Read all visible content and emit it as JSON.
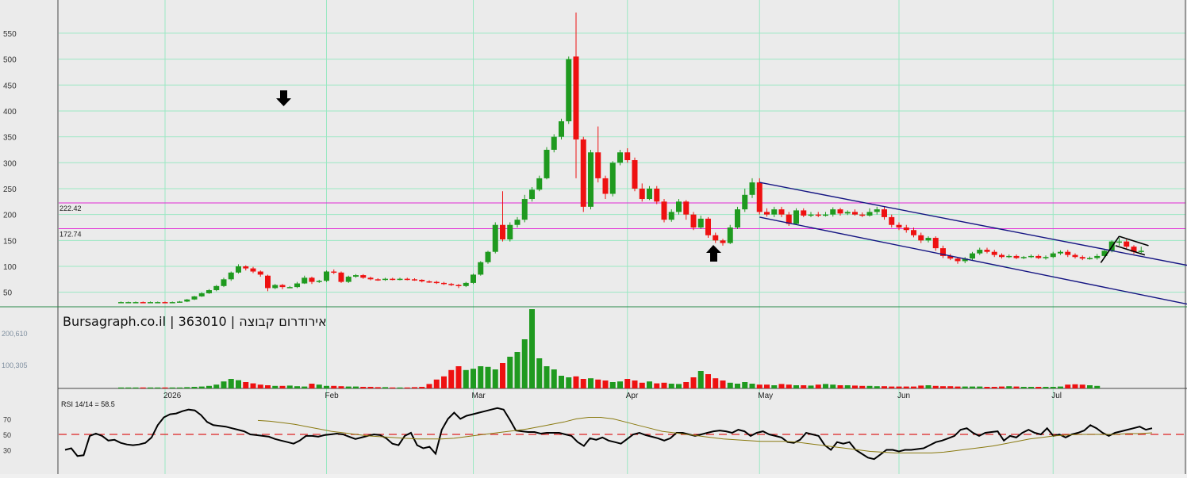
{
  "chart_data": {
    "type": "candlestick",
    "title": "Bursagraph.co.il | 363010 | אירודרום קבוצה",
    "colors": {
      "up": "#1f9a1f",
      "down": "#ee1111",
      "grid": "#9be8c3",
      "hline": "#e22ad6",
      "channel": "#141482",
      "rsi": "#000000",
      "rsi_ma": "#8a7a10",
      "rsi_level": "#dd2222",
      "background": "#ebebeb"
    },
    "price_axis": {
      "ticks": [
        50,
        100,
        150,
        200,
        250,
        300,
        350,
        400,
        450,
        500,
        550
      ],
      "ylim": [
        25,
        600
      ]
    },
    "horizontal_levels": [
      {
        "label": "222.42",
        "value": 222.42
      },
      {
        "label": "172.74",
        "value": 172.74
      }
    ],
    "month_labels": [
      {
        "label": "2026",
        "day": 0
      },
      {
        "label": "Feb",
        "day": 22
      },
      {
        "label": "Mar",
        "day": 42
      },
      {
        "label": "Apr",
        "day": 63
      },
      {
        "label": "May",
        "day": 81
      },
      {
        "label": "Jun",
        "day": 100
      },
      {
        "label": "Jul",
        "day": 121
      }
    ],
    "grid_days": [
      -15,
      0,
      22,
      42,
      63,
      81,
      100,
      121,
      140
    ],
    "candles": [
      [
        -6,
        30,
        31,
        32,
        29
      ],
      [
        -5,
        30,
        31,
        32,
        29
      ],
      [
        -4,
        30,
        31,
        32,
        29
      ],
      [
        -3,
        31,
        30,
        32,
        29
      ],
      [
        -2,
        30,
        31,
        32,
        29
      ],
      [
        -1,
        31,
        31,
        32,
        29
      ],
      [
        0,
        31,
        30,
        32,
        29
      ],
      [
        1,
        30,
        31,
        32,
        29
      ],
      [
        2,
        31,
        32,
        33,
        30
      ],
      [
        3,
        32,
        36,
        37,
        31
      ],
      [
        4,
        36,
        42,
        43,
        35
      ],
      [
        5,
        42,
        48,
        50,
        41
      ],
      [
        6,
        48,
        54,
        56,
        47
      ],
      [
        7,
        54,
        62,
        64,
        52
      ],
      [
        8,
        62,
        75,
        78,
        60
      ],
      [
        9,
        75,
        88,
        90,
        72
      ],
      [
        10,
        88,
        100,
        104,
        86
      ],
      [
        11,
        100,
        96,
        102,
        92
      ],
      [
        12,
        96,
        90,
        99,
        87
      ],
      [
        13,
        90,
        84,
        92,
        80
      ],
      [
        14,
        82,
        58,
        84,
        52
      ],
      [
        15,
        58,
        64,
        66,
        56
      ],
      [
        16,
        64,
        60,
        66,
        56
      ],
      [
        17,
        60,
        60,
        62,
        58
      ],
      [
        18,
        60,
        67,
        70,
        58
      ],
      [
        19,
        67,
        78,
        82,
        66
      ],
      [
        20,
        78,
        70,
        80,
        66
      ],
      [
        21,
        70,
        72,
        74,
        68
      ],
      [
        22,
        72,
        90,
        92,
        70
      ],
      [
        23,
        90,
        88,
        94,
        85
      ],
      [
        24,
        88,
        70,
        90,
        68
      ],
      [
        25,
        70,
        80,
        82,
        68
      ],
      [
        26,
        80,
        83,
        85,
        78
      ],
      [
        27,
        83,
        78,
        85,
        76
      ],
      [
        28,
        78,
        75,
        80,
        73
      ],
      [
        29,
        75,
        74,
        77,
        72
      ],
      [
        30,
        74,
        76,
        78,
        72
      ],
      [
        31,
        76,
        75,
        78,
        73
      ],
      [
        32,
        75,
        76,
        78,
        73
      ],
      [
        33,
        76,
        75,
        78,
        73
      ],
      [
        34,
        75,
        74,
        77,
        72
      ],
      [
        35,
        74,
        71,
        75,
        69
      ],
      [
        36,
        71,
        70,
        73,
        68
      ],
      [
        37,
        70,
        68,
        72,
        66
      ],
      [
        38,
        68,
        66,
        70,
        64
      ],
      [
        39,
        66,
        64,
        68,
        62
      ],
      [
        40,
        64,
        62,
        66,
        58
      ],
      [
        41,
        62,
        68,
        70,
        60
      ],
      [
        42,
        68,
        84,
        86,
        66
      ],
      [
        43,
        84,
        108,
        110,
        82
      ],
      [
        44,
        108,
        128,
        130,
        105
      ],
      [
        45,
        128,
        180,
        185,
        125
      ],
      [
        46,
        180,
        152,
        245,
        148
      ],
      [
        47,
        152,
        180,
        185,
        148
      ],
      [
        48,
        180,
        190,
        195,
        175
      ],
      [
        49,
        190,
        230,
        238,
        185
      ],
      [
        50,
        230,
        248,
        253,
        225
      ],
      [
        51,
        248,
        270,
        275,
        245
      ],
      [
        52,
        270,
        325,
        330,
        268
      ],
      [
        53,
        325,
        350,
        355,
        320
      ],
      [
        54,
        350,
        380,
        385,
        345
      ],
      [
        55,
        380,
        500,
        505,
        375
      ],
      [
        56,
        505,
        345,
        590,
        270
      ],
      [
        57,
        345,
        215,
        350,
        205
      ],
      [
        58,
        215,
        320,
        325,
        210
      ],
      [
        59,
        320,
        270,
        370,
        262
      ],
      [
        60,
        270,
        240,
        275,
        230
      ],
      [
        61,
        240,
        300,
        303,
        235
      ],
      [
        62,
        300,
        320,
        325,
        295
      ],
      [
        63,
        320,
        305,
        328,
        300
      ],
      [
        64,
        305,
        250,
        310,
        245
      ],
      [
        65,
        250,
        230,
        260,
        225
      ],
      [
        66,
        230,
        250,
        255,
        228
      ],
      [
        67,
        250,
        225,
        255,
        220
      ],
      [
        68,
        225,
        190,
        230,
        185
      ],
      [
        69,
        190,
        205,
        210,
        186
      ],
      [
        70,
        205,
        225,
        230,
        200
      ],
      [
        71,
        225,
        200,
        228,
        190
      ],
      [
        72,
        200,
        175,
        205,
        170
      ],
      [
        73,
        175,
        192,
        198,
        172
      ],
      [
        74,
        192,
        160,
        195,
        155
      ],
      [
        75,
        160,
        150,
        165,
        145
      ],
      [
        76,
        150,
        145,
        153,
        140
      ],
      [
        77,
        145,
        175,
        180,
        143
      ],
      [
        78,
        175,
        210,
        215,
        172
      ],
      [
        79,
        210,
        238,
        250,
        205
      ],
      [
        80,
        238,
        262,
        270,
        232
      ],
      [
        81,
        262,
        205,
        270,
        200
      ],
      [
        82,
        205,
        200,
        212,
        196
      ],
      [
        83,
        200,
        210,
        215,
        195
      ],
      [
        84,
        210,
        200,
        215,
        195
      ],
      [
        85,
        200,
        182,
        205,
        178
      ],
      [
        86,
        182,
        208,
        212,
        180
      ],
      [
        87,
        208,
        198,
        212,
        195
      ],
      [
        88,
        198,
        200,
        205,
        195
      ],
      [
        89,
        200,
        198,
        205,
        195
      ],
      [
        90,
        198,
        200,
        205,
        196
      ],
      [
        91,
        200,
        210,
        214,
        196
      ],
      [
        92,
        210,
        202,
        213,
        198
      ],
      [
        93,
        202,
        205,
        208,
        199
      ],
      [
        94,
        205,
        200,
        210,
        198
      ],
      [
        95,
        200,
        198,
        204,
        195
      ],
      [
        96,
        198,
        205,
        212,
        196
      ],
      [
        97,
        205,
        210,
        215,
        200
      ],
      [
        98,
        210,
        195,
        215,
        190
      ],
      [
        99,
        195,
        180,
        200,
        175
      ],
      [
        100,
        180,
        175,
        185,
        170
      ],
      [
        101,
        175,
        170,
        180,
        165
      ],
      [
        102,
        170,
        160,
        175,
        156
      ],
      [
        103,
        160,
        150,
        165,
        145
      ],
      [
        104,
        150,
        155,
        158,
        146
      ],
      [
        105,
        155,
        135,
        158,
        130
      ],
      [
        106,
        135,
        120,
        140,
        116
      ],
      [
        107,
        120,
        115,
        124,
        112
      ],
      [
        108,
        115,
        110,
        118,
        105
      ],
      [
        109,
        110,
        115,
        118,
        106
      ],
      [
        110,
        115,
        125,
        128,
        112
      ],
      [
        111,
        125,
        132,
        136,
        122
      ],
      [
        112,
        132,
        128,
        136,
        125
      ],
      [
        113,
        128,
        122,
        132,
        118
      ],
      [
        114,
        122,
        118,
        125,
        115
      ],
      [
        115,
        118,
        120,
        123,
        116
      ],
      [
        116,
        120,
        116,
        123,
        114
      ],
      [
        117,
        116,
        118,
        120,
        114
      ],
      [
        118,
        118,
        120,
        123,
        116
      ],
      [
        119,
        120,
        116,
        123,
        114
      ],
      [
        120,
        116,
        118,
        121,
        113
      ],
      [
        121,
        118,
        125,
        128,
        116
      ],
      [
        122,
        125,
        128,
        131,
        122
      ],
      [
        123,
        128,
        122,
        132,
        118
      ],
      [
        124,
        122,
        118,
        125,
        115
      ],
      [
        125,
        118,
        115,
        121,
        112
      ],
      [
        126,
        115,
        116,
        119,
        113
      ],
      [
        127,
        116,
        120,
        124,
        113
      ],
      [
        128,
        120,
        130,
        133,
        117
      ],
      [
        129,
        130,
        148,
        150,
        127
      ],
      [
        130,
        148,
        148,
        155,
        140
      ],
      [
        131,
        148,
        138,
        152,
        134
      ],
      [
        132,
        138,
        128,
        141,
        124
      ],
      [
        133,
        128,
        130,
        138,
        126
      ]
    ],
    "volume": {
      "ticks": [
        {
          "label": "100,305",
          "value": 100305
        },
        {
          "label": "200,610",
          "value": 200610
        }
      ],
      "ymax": 250000,
      "values": [
        3000,
        3000,
        3000,
        3000,
        3000,
        3000,
        3000,
        3000,
        3000,
        4000,
        5000,
        6000,
        8000,
        12000,
        22000,
        30000,
        26000,
        20000,
        16000,
        12000,
        10000,
        8000,
        8000,
        9000,
        7000,
        6000,
        15000,
        12000,
        8000,
        8000,
        7000,
        6000,
        6000,
        5000,
        5000,
        4000,
        4000,
        3000,
        3000,
        3000,
        4000,
        5000,
        14000,
        28000,
        38000,
        58000,
        70000,
        58000,
        62000,
        70000,
        68000,
        60000,
        80000,
        100000,
        115000,
        155000,
        250000,
        95000,
        70000,
        60000,
        40000,
        35000,
        38000,
        30000,
        32000,
        28000,
        25000,
        20000,
        22000,
        30000,
        25000,
        18000,
        22000,
        16000,
        18000,
        15000,
        14000,
        20000,
        35000,
        55000,
        45000,
        32000,
        25000,
        18000,
        15000,
        20000,
        15000,
        12000,
        12000,
        10000,
        14000,
        12000,
        10000,
        10000,
        9000,
        12000,
        14000,
        12000,
        10000,
        10000,
        9000,
        8000,
        8000,
        7000,
        7000,
        6000,
        6000,
        6000,
        6000,
        9000,
        10000,
        8000,
        7000,
        7000,
        6000,
        6000,
        6000,
        6000,
        5000,
        5000,
        6000,
        7000,
        6000,
        5000,
        5000,
        5000,
        5000,
        5000,
        6000,
        12000,
        13000,
        12000,
        10000,
        8000
      ]
    },
    "rsi": {
      "label": "RSI 14/14 = 58.5",
      "ticks": [
        30,
        50,
        70
      ],
      "level": 50,
      "values": [
        30,
        32,
        22,
        23,
        48,
        51,
        48,
        42,
        43,
        39,
        37,
        36,
        37,
        39,
        46,
        62,
        72,
        76,
        77,
        80,
        82,
        81,
        75,
        66,
        62,
        61,
        60,
        58,
        56,
        54,
        50,
        49,
        48,
        47,
        44,
        42,
        40,
        38,
        42,
        48,
        48,
        47,
        49,
        50,
        51,
        50,
        47,
        44,
        46,
        48,
        50,
        49,
        45,
        38,
        36,
        48,
        52,
        36,
        32,
        34,
        25,
        56,
        70,
        78,
        70,
        74,
        76,
        78,
        80,
        82,
        84,
        82,
        69,
        55,
        54,
        53,
        53,
        51,
        52,
        52,
        52,
        50,
        48,
        40,
        35,
        45,
        43,
        46,
        42,
        40,
        38,
        44,
        50,
        52,
        49,
        47,
        45,
        42,
        45,
        52,
        52,
        50,
        48,
        50,
        52,
        54,
        55,
        54,
        52,
        56,
        54,
        48,
        52,
        54,
        50,
        48,
        46,
        40,
        39,
        43,
        52,
        50,
        48,
        36,
        30,
        40,
        38,
        40,
        30,
        25,
        20,
        18,
        24,
        30,
        30,
        28,
        30,
        30,
        31,
        32,
        36,
        40,
        42,
        45,
        48,
        56,
        58,
        52,
        48,
        52,
        53,
        54,
        42,
        48,
        46,
        52,
        56,
        52,
        50,
        58,
        48,
        50,
        46,
        50,
        52,
        55,
        62,
        58,
        52,
        48,
        52,
        54,
        56,
        58,
        60,
        56,
        58
      ],
      "ma": [
        68,
        67,
        65,
        63,
        60,
        57,
        54,
        52,
        50,
        48,
        47,
        46,
        45,
        44,
        44,
        44,
        45,
        47,
        49,
        51,
        53,
        55,
        57,
        60,
        63,
        66,
        70,
        72,
        72,
        70,
        66,
        62,
        58,
        54,
        52,
        50,
        48,
        46,
        44,
        43,
        42,
        41,
        41,
        41,
        40,
        38,
        36,
        34,
        32,
        30,
        28,
        27,
        26,
        26,
        26,
        26,
        27,
        29,
        31,
        33,
        35,
        38,
        41,
        44,
        46,
        48,
        49,
        50,
        50,
        50,
        50,
        51,
        51,
        52
      ],
      "ma_start": 13
    }
  }
}
